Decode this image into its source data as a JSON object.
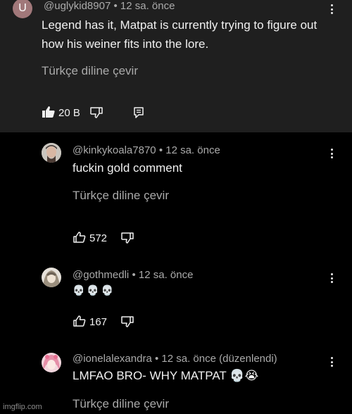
{
  "top_comment": {
    "avatar_letter": "U",
    "author": "@uglykid8907",
    "time": "12 sa. önce",
    "text": "Legend has it, Matpat is currently trying to figure out how his weiner fits into the lore.",
    "translate": "Türkçe diline çevir",
    "likes": "20 B"
  },
  "replies": [
    {
      "author": "@kinkykoala7870",
      "time": "12 sa. önce",
      "text": "fuckin gold comment",
      "translate": "Türkçe diline çevir",
      "likes": "572"
    },
    {
      "author": "@gothmedli",
      "time": "12 sa. önce",
      "text": "💀💀💀",
      "likes": "167"
    },
    {
      "author": "@ionelalexandra",
      "time": "12 sa. önce (düzenlendi)",
      "text": "LMFAO BRO- WHY MATPAT 💀😭",
      "translate": "Türkçe diline çevir"
    }
  ],
  "watermark": "imgflip.com",
  "icons": {
    "more": "vertical-dots-icon",
    "like": "thumbs-up-icon",
    "dislike": "thumbs-down-icon",
    "reply": "reply-comment-icon"
  },
  "colors": {
    "top_background": "#1f1f1f",
    "reply_background": "#000000",
    "secondary_text": "#aaaaaa",
    "primary_text": "#f1f1f1",
    "avatar_u": "#a1787a"
  }
}
